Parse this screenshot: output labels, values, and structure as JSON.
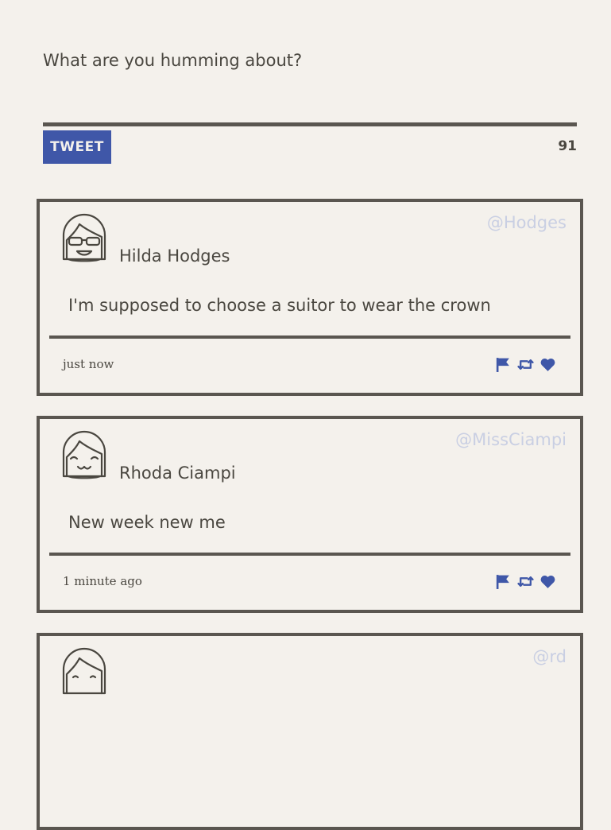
{
  "composer": {
    "placeholder": "What are you humming about?",
    "button_label": "TWEET",
    "char_count": "91"
  },
  "tweets": [
    {
      "name": "Hilda Hodges",
      "handle": "@Hodges",
      "text": "I'm supposed to choose a suitor to wear the crown",
      "time": "just now",
      "avatar": "avatar-sunglasses-icon"
    },
    {
      "name": "Rhoda Ciampi",
      "handle": "@MissCiampi",
      "text": "New week new me",
      "time": "1 minute ago",
      "avatar": "avatar-smiling-icon"
    },
    {
      "name": "",
      "handle": "@rd",
      "text": "",
      "time": "",
      "avatar": "avatar-icon"
    }
  ],
  "colors": {
    "accent": "#3f57a8",
    "handle": "#c9cfe3",
    "border": "#5a5650",
    "background": "#f4f1ec"
  }
}
